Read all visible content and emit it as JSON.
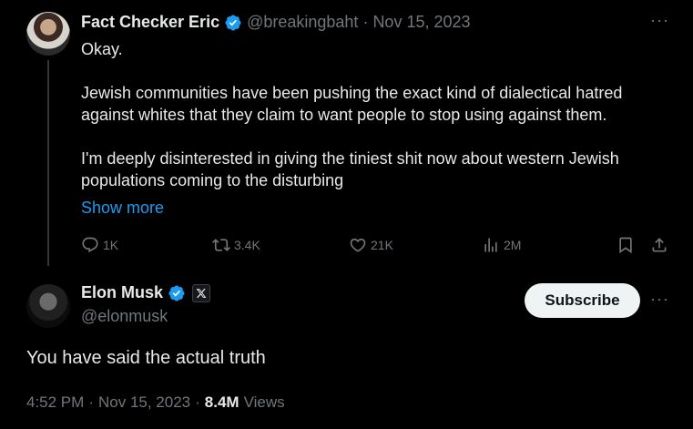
{
  "original_tweet": {
    "author_name": "Fact Checker Eric",
    "handle": "@breakingbaht",
    "separator": "·",
    "date": "Nov 15, 2023",
    "paragraphs": [
      "Okay.",
      "Jewish communities have been pushing the exact kind of dialectical hatred against whites that they claim to want people to stop using against them.",
      "I'm deeply disinterested in giving the tiniest shit now about western Jewish populations coming to the disturbing"
    ],
    "show_more": "Show more",
    "stats": {
      "replies": "1K",
      "reposts": "3.4K",
      "likes": "21K",
      "views": "2M"
    },
    "icons": [
      "verified-badge-icon",
      "more-icon",
      "reply-icon",
      "repost-icon",
      "like-icon",
      "views-icon",
      "bookmark-icon",
      "share-icon"
    ]
  },
  "reply_tweet": {
    "author_name": "Elon Musk",
    "handle": "@elonmusk",
    "subscribe_label": "Subscribe",
    "text": "You have said the actual truth",
    "time": "4:52 PM",
    "separator": "·",
    "date": "Nov 15, 2023",
    "views_count": "8.4M",
    "views_label": "Views",
    "icons": [
      "verified-badge-icon",
      "x-affiliate-icon",
      "more-icon"
    ]
  },
  "colors": {
    "background": "#000000",
    "text_primary": "#e7e9ea",
    "text_secondary": "#71767b",
    "accent": "#1d9bf0",
    "divider": "#333639"
  }
}
